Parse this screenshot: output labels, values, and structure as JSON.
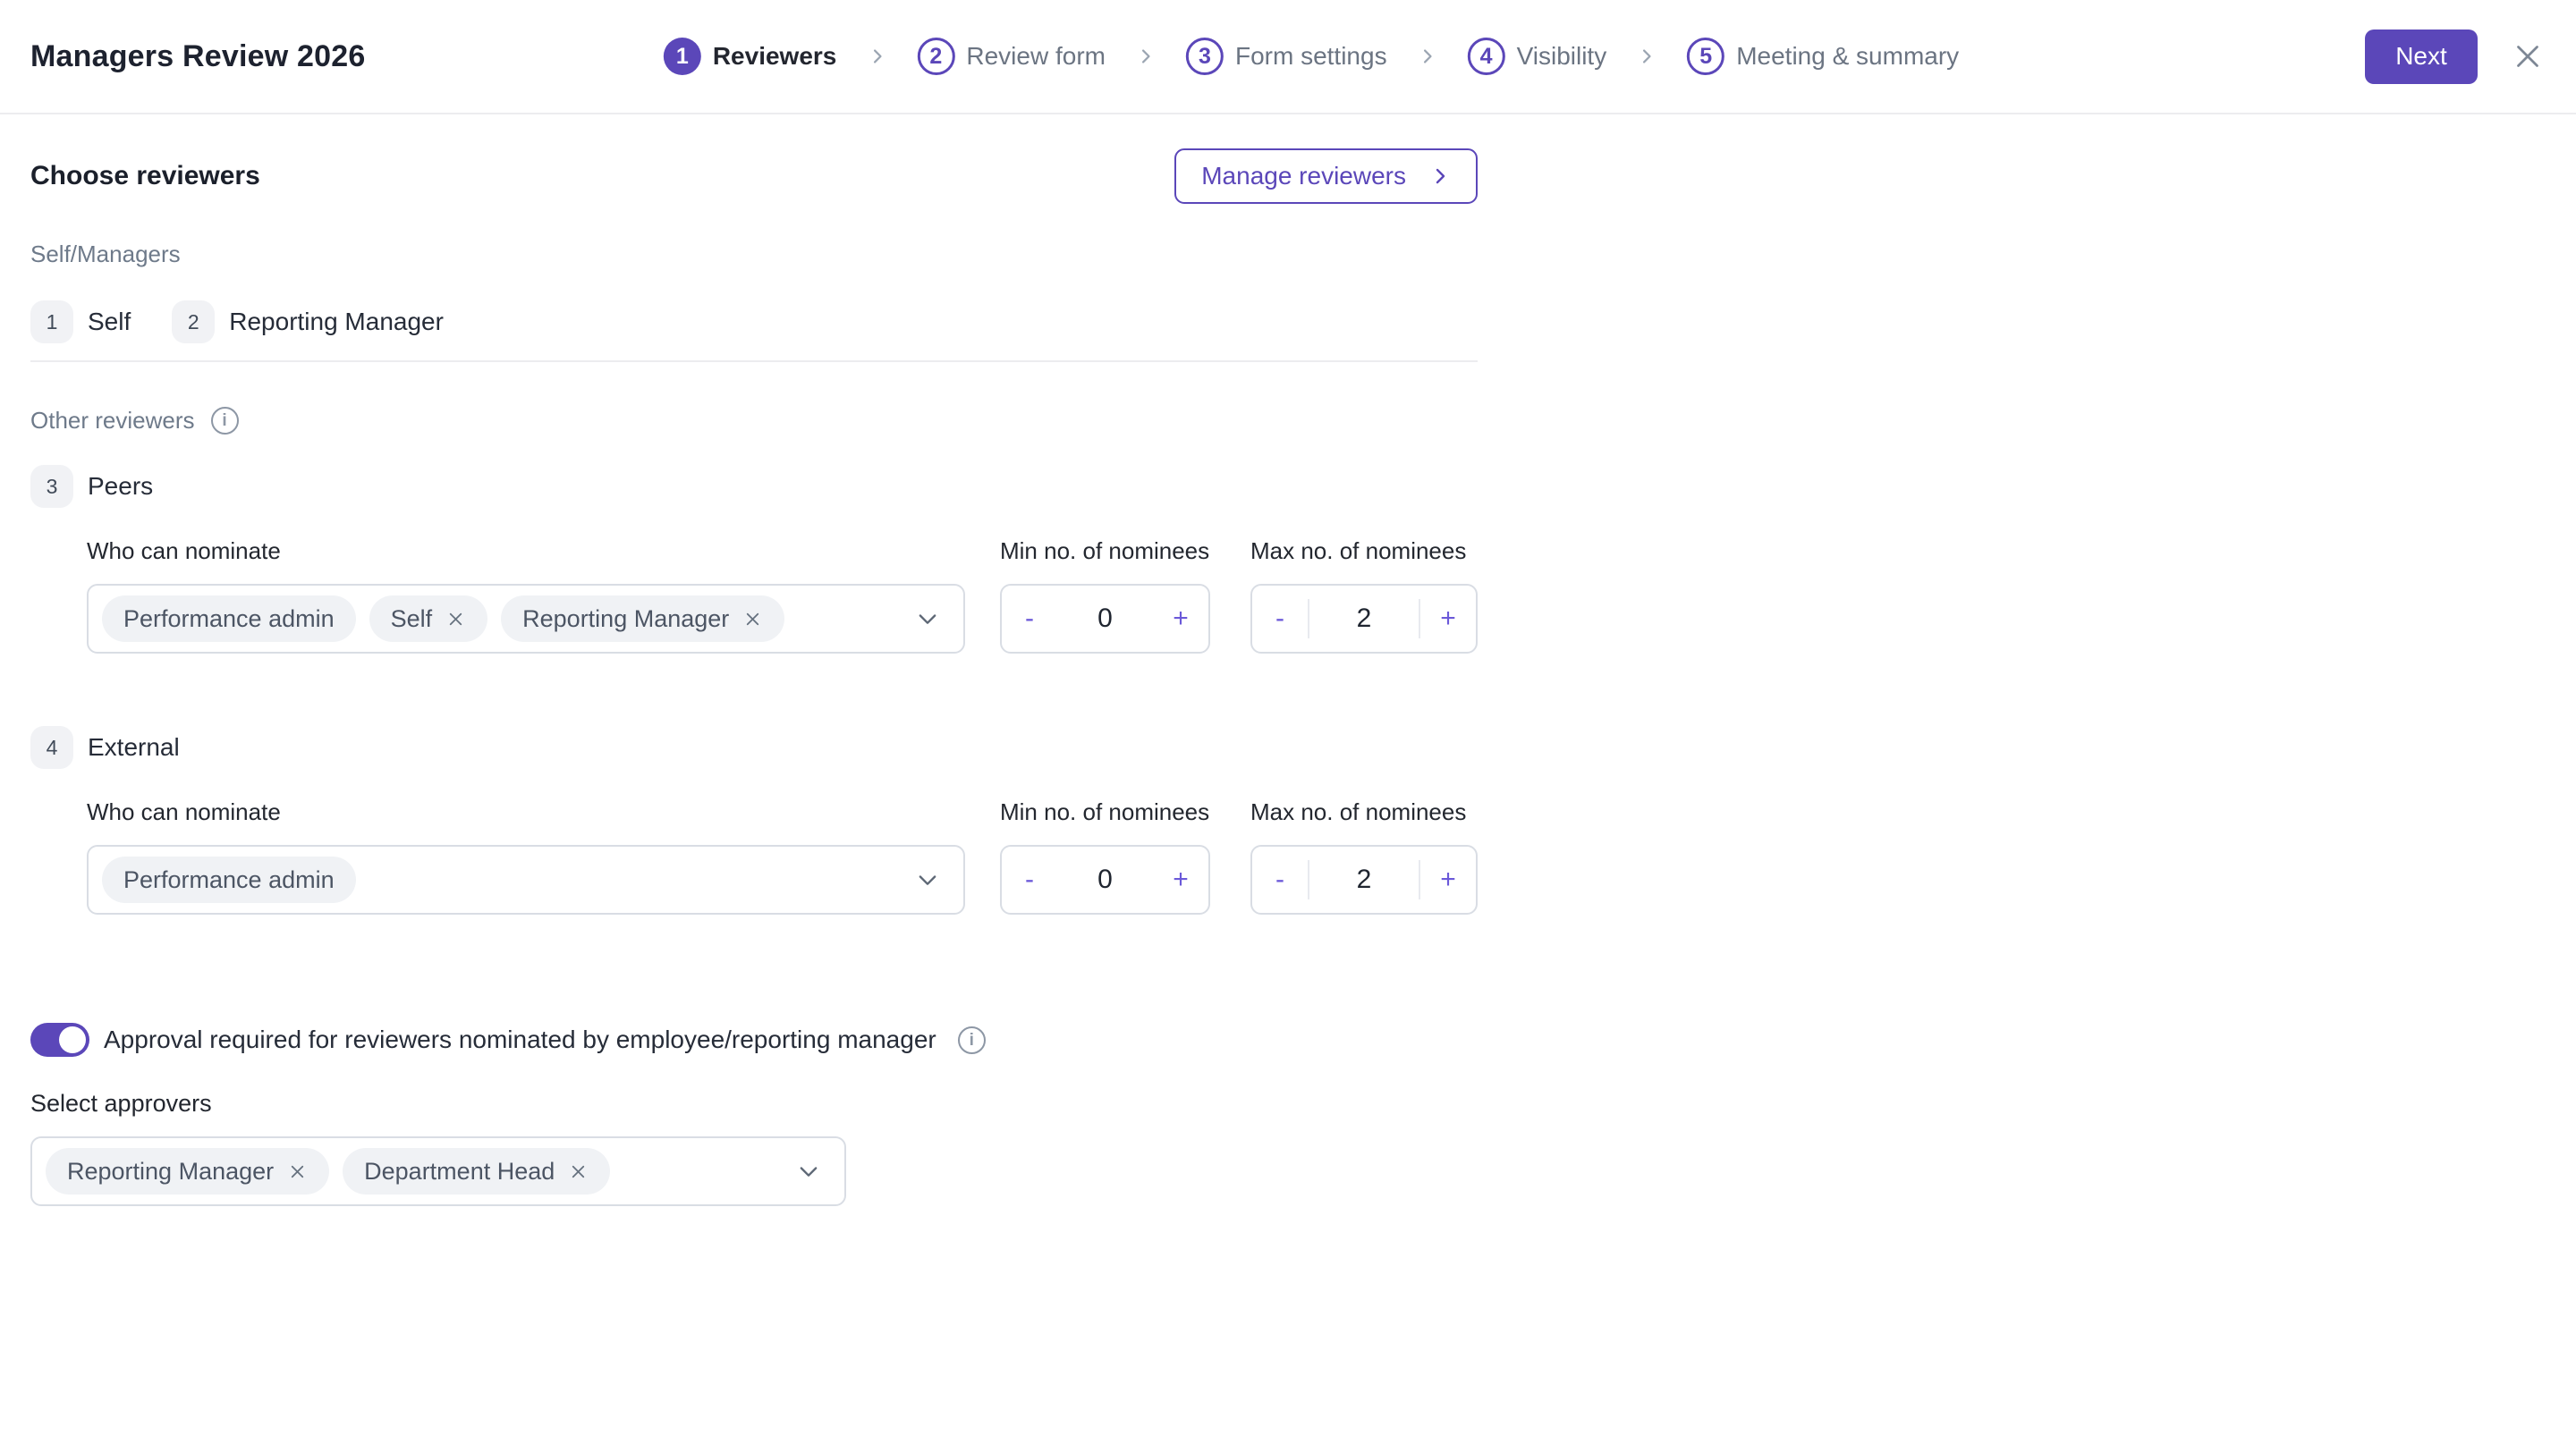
{
  "header": {
    "title": "Managers Review 2026",
    "steps": [
      {
        "number": "1",
        "label": "Reviewers"
      },
      {
        "number": "2",
        "label": "Review form"
      },
      {
        "number": "3",
        "label": "Form settings"
      },
      {
        "number": "4",
        "label": "Visibility"
      },
      {
        "number": "5",
        "label": "Meeting & summary"
      }
    ],
    "next_label": "Next"
  },
  "content": {
    "heading": "Choose reviewers",
    "manage_button": {
      "label": "Manage reviewers"
    },
    "self_managers": {
      "label": "Self/Managers",
      "items": [
        {
          "number": "1",
          "label": "Self"
        },
        {
          "number": "2",
          "label": "Reporting Manager"
        }
      ]
    },
    "other_reviewers": {
      "label": "Other reviewers"
    },
    "groups": [
      {
        "number": "3",
        "name": "Peers",
        "who_label": "Who can nominate",
        "chips": [
          {
            "label": "Performance admin",
            "removable": false
          },
          {
            "label": "Self",
            "removable": true
          },
          {
            "label": "Reporting Manager",
            "removable": true
          }
        ],
        "min_label": "Min no. of nominees",
        "min_value": "0",
        "max_label": "Max no. of nominees",
        "max_value": "2"
      },
      {
        "number": "4",
        "name": "External",
        "who_label": "Who can nominate",
        "chips": [
          {
            "label": "Performance admin",
            "removable": false
          }
        ],
        "min_label": "Min no. of nominees",
        "min_value": "0",
        "max_label": "Max no. of nominees",
        "max_value": "2"
      }
    ],
    "approval": {
      "toggle_on": true,
      "label": "Approval required for reviewers nominated by employee/reporting manager"
    },
    "approvers": {
      "label": "Select approvers",
      "chips": [
        {
          "label": "Reporting Manager",
          "removable": true
        },
        {
          "label": "Department Head",
          "removable": true
        }
      ]
    }
  },
  "controls": {
    "minus": "-",
    "plus": "+"
  },
  "icons": {
    "info": "i"
  },
  "colors": {
    "primary": "#5b47b9",
    "chip_bg": "#f0f2f5",
    "border": "#d9dde4",
    "muted_text": "#6e7a8a",
    "dark_text": "#20242e"
  }
}
